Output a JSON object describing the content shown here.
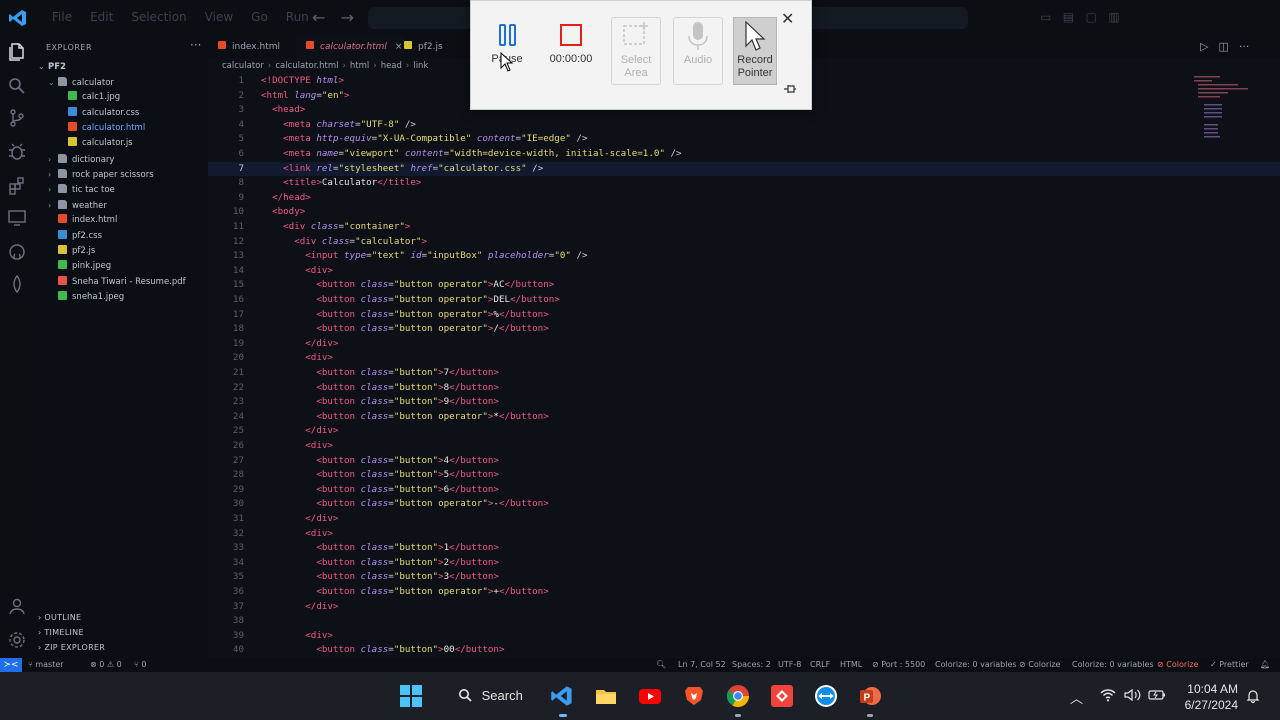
{
  "window": {
    "menu": [
      "File",
      "Edit",
      "Selection",
      "View",
      "Go",
      "Run"
    ]
  },
  "sidebar": {
    "header": "EXPLORER",
    "more": "···",
    "root": "PF2",
    "items": [
      {
        "label": "calculator",
        "type": "folder",
        "open": true,
        "indent": 1
      },
      {
        "label": "calc1.jpg",
        "type": "img",
        "indent": 2
      },
      {
        "label": "calculator.css",
        "type": "css",
        "indent": 2
      },
      {
        "label": "calculator.html",
        "type": "html",
        "indent": 2,
        "active": true
      },
      {
        "label": "calculator.js",
        "type": "js",
        "indent": 2
      },
      {
        "label": "dictionary",
        "type": "folder",
        "indent": 1
      },
      {
        "label": "rock paper scissors",
        "type": "folder",
        "indent": 1
      },
      {
        "label": "tic tac toe",
        "type": "folder",
        "indent": 1
      },
      {
        "label": "weather",
        "type": "folder",
        "indent": 1
      },
      {
        "label": "index.html",
        "type": "html",
        "indent": 1
      },
      {
        "label": "pf2.css",
        "type": "css",
        "indent": 1
      },
      {
        "label": "pf2.js",
        "type": "js",
        "indent": 1
      },
      {
        "label": "pink.jpeg",
        "type": "img",
        "indent": 1
      },
      {
        "label": "Sneha Tiwari - Resume.pdf",
        "type": "pdf",
        "indent": 1
      },
      {
        "label": "sneha1.jpeg",
        "type": "img",
        "indent": 1
      }
    ],
    "sections": [
      "OUTLINE",
      "TIMELINE",
      "ZIP EXPLORER"
    ]
  },
  "tabs": [
    {
      "label": "index.html",
      "type": "html"
    },
    {
      "label": "calculator.html",
      "type": "html",
      "active": true,
      "close": "×"
    },
    {
      "label": "pf2.js",
      "type": "js"
    }
  ],
  "breadcrumb": [
    "calculator",
    "calculator.html",
    "html",
    "head",
    "link"
  ],
  "editor": {
    "current_line": 7,
    "lines": [
      [
        [
          "doc",
          "<!DOCTYPE "
        ],
        [
          "attr",
          "html"
        ],
        [
          "doc",
          ">"
        ]
      ],
      [
        [
          "tag",
          "<html "
        ],
        [
          "attr",
          "lang"
        ],
        [
          "punc",
          "="
        ],
        [
          "str",
          "\"en\""
        ],
        [
          "tag",
          ">"
        ]
      ],
      [
        [
          "txt",
          "  "
        ],
        [
          "tag",
          "<head>"
        ]
      ],
      [
        [
          "txt",
          "    "
        ],
        [
          "tag",
          "<meta "
        ],
        [
          "attr",
          "charset"
        ],
        [
          "punc",
          "="
        ],
        [
          "str",
          "\"UTF-8\""
        ],
        [
          "punc",
          " />"
        ]
      ],
      [
        [
          "txt",
          "    "
        ],
        [
          "tag",
          "<meta "
        ],
        [
          "attr",
          "http-equiv"
        ],
        [
          "punc",
          "="
        ],
        [
          "str",
          "\"X-UA-Compatible\""
        ],
        [
          "punc",
          " "
        ],
        [
          "attr",
          "content"
        ],
        [
          "punc",
          "="
        ],
        [
          "str",
          "\"IE=edge\""
        ],
        [
          "punc",
          " />"
        ]
      ],
      [
        [
          "txt",
          "    "
        ],
        [
          "tag",
          "<meta "
        ],
        [
          "attr",
          "name"
        ],
        [
          "punc",
          "="
        ],
        [
          "str",
          "\"viewport\""
        ],
        [
          "punc",
          " "
        ],
        [
          "attr",
          "content"
        ],
        [
          "punc",
          "="
        ],
        [
          "str",
          "\"width=device-width, initial-scale=1.0\""
        ],
        [
          "punc",
          " />"
        ]
      ],
      [
        [
          "txt",
          "    "
        ],
        [
          "tag",
          "<link "
        ],
        [
          "attr",
          "rel"
        ],
        [
          "punc",
          "="
        ],
        [
          "str",
          "\"stylesheet\""
        ],
        [
          "punc",
          " "
        ],
        [
          "attr",
          "href"
        ],
        [
          "punc",
          "="
        ],
        [
          "str",
          "\"calculator.css\""
        ],
        [
          "punc",
          " />"
        ]
      ],
      [
        [
          "txt",
          "    "
        ],
        [
          "tag",
          "<title>"
        ],
        [
          "txt",
          "Calculator"
        ],
        [
          "tag",
          "</title>"
        ]
      ],
      [
        [
          "txt",
          "  "
        ],
        [
          "tag",
          "</head>"
        ]
      ],
      [
        [
          "txt",
          "  "
        ],
        [
          "tag",
          "<body>"
        ]
      ],
      [
        [
          "txt",
          "    "
        ],
        [
          "tag",
          "<div "
        ],
        [
          "attr",
          "class"
        ],
        [
          "punc",
          "="
        ],
        [
          "str",
          "\"container\""
        ],
        [
          "tag",
          ">"
        ]
      ],
      [
        [
          "txt",
          "      "
        ],
        [
          "tag",
          "<div "
        ],
        [
          "attr",
          "class"
        ],
        [
          "punc",
          "="
        ],
        [
          "str",
          "\"calculator\""
        ],
        [
          "tag",
          ">"
        ]
      ],
      [
        [
          "txt",
          "        "
        ],
        [
          "tag",
          "<input "
        ],
        [
          "attr",
          "type"
        ],
        [
          "punc",
          "="
        ],
        [
          "str",
          "\"text\""
        ],
        [
          "punc",
          " "
        ],
        [
          "attr",
          "id"
        ],
        [
          "punc",
          "="
        ],
        [
          "str",
          "\"inputBox\""
        ],
        [
          "punc",
          " "
        ],
        [
          "attr",
          "placeholder"
        ],
        [
          "punc",
          "="
        ],
        [
          "str",
          "\"0\""
        ],
        [
          "punc",
          " />"
        ]
      ],
      [
        [
          "txt",
          "        "
        ],
        [
          "tag",
          "<div>"
        ]
      ],
      [
        [
          "txt",
          "          "
        ],
        [
          "tag",
          "<button "
        ],
        [
          "attr",
          "class"
        ],
        [
          "punc",
          "="
        ],
        [
          "str",
          "\"button operator\""
        ],
        [
          "tag",
          ">"
        ],
        [
          "txt",
          "AC"
        ],
        [
          "tag",
          "</button>"
        ]
      ],
      [
        [
          "txt",
          "          "
        ],
        [
          "tag",
          "<button "
        ],
        [
          "attr",
          "class"
        ],
        [
          "punc",
          "="
        ],
        [
          "str",
          "\"button operator\""
        ],
        [
          "tag",
          ">"
        ],
        [
          "txt",
          "DEL"
        ],
        [
          "tag",
          "</button>"
        ]
      ],
      [
        [
          "txt",
          "          "
        ],
        [
          "tag",
          "<button "
        ],
        [
          "attr",
          "class"
        ],
        [
          "punc",
          "="
        ],
        [
          "str",
          "\"button operator\""
        ],
        [
          "tag",
          ">"
        ],
        [
          "txt",
          "%"
        ],
        [
          "tag",
          "</button>"
        ]
      ],
      [
        [
          "txt",
          "          "
        ],
        [
          "tag",
          "<button "
        ],
        [
          "attr",
          "class"
        ],
        [
          "punc",
          "="
        ],
        [
          "str",
          "\"button operator\""
        ],
        [
          "tag",
          ">"
        ],
        [
          "txt",
          "/"
        ],
        [
          "tag",
          "</button>"
        ]
      ],
      [
        [
          "txt",
          "        "
        ],
        [
          "tag",
          "</div>"
        ]
      ],
      [
        [
          "txt",
          "        "
        ],
        [
          "tag",
          "<div>"
        ]
      ],
      [
        [
          "txt",
          "          "
        ],
        [
          "tag",
          "<button "
        ],
        [
          "attr",
          "class"
        ],
        [
          "punc",
          "="
        ],
        [
          "str",
          "\"button\""
        ],
        [
          "tag",
          ">"
        ],
        [
          "txt",
          "7"
        ],
        [
          "tag",
          "</button>"
        ]
      ],
      [
        [
          "txt",
          "          "
        ],
        [
          "tag",
          "<button "
        ],
        [
          "attr",
          "class"
        ],
        [
          "punc",
          "="
        ],
        [
          "str",
          "\"button\""
        ],
        [
          "tag",
          ">"
        ],
        [
          "txt",
          "8"
        ],
        [
          "tag",
          "</button>"
        ]
      ],
      [
        [
          "txt",
          "          "
        ],
        [
          "tag",
          "<button "
        ],
        [
          "attr",
          "class"
        ],
        [
          "punc",
          "="
        ],
        [
          "str",
          "\"button\""
        ],
        [
          "tag",
          ">"
        ],
        [
          "txt",
          "9"
        ],
        [
          "tag",
          "</button>"
        ]
      ],
      [
        [
          "txt",
          "          "
        ],
        [
          "tag",
          "<button "
        ],
        [
          "attr",
          "class"
        ],
        [
          "punc",
          "="
        ],
        [
          "str",
          "\"button operator\""
        ],
        [
          "tag",
          ">"
        ],
        [
          "txt",
          "*"
        ],
        [
          "tag",
          "</button>"
        ]
      ],
      [
        [
          "txt",
          "        "
        ],
        [
          "tag",
          "</div>"
        ]
      ],
      [
        [
          "txt",
          "        "
        ],
        [
          "tag",
          "<div>"
        ]
      ],
      [
        [
          "txt",
          "          "
        ],
        [
          "tag",
          "<button "
        ],
        [
          "attr",
          "class"
        ],
        [
          "punc",
          "="
        ],
        [
          "str",
          "\"button\""
        ],
        [
          "tag",
          ">"
        ],
        [
          "txt",
          "4"
        ],
        [
          "tag",
          "</button>"
        ]
      ],
      [
        [
          "txt",
          "          "
        ],
        [
          "tag",
          "<button "
        ],
        [
          "attr",
          "class"
        ],
        [
          "punc",
          "="
        ],
        [
          "str",
          "\"button\""
        ],
        [
          "tag",
          ">"
        ],
        [
          "txt",
          "5"
        ],
        [
          "tag",
          "</button>"
        ]
      ],
      [
        [
          "txt",
          "          "
        ],
        [
          "tag",
          "<button "
        ],
        [
          "attr",
          "class"
        ],
        [
          "punc",
          "="
        ],
        [
          "str",
          "\"button\""
        ],
        [
          "tag",
          ">"
        ],
        [
          "txt",
          "6"
        ],
        [
          "tag",
          "</button>"
        ]
      ],
      [
        [
          "txt",
          "          "
        ],
        [
          "tag",
          "<button "
        ],
        [
          "attr",
          "class"
        ],
        [
          "punc",
          "="
        ],
        [
          "str",
          "\"button operator\""
        ],
        [
          "tag",
          ">"
        ],
        [
          "txt",
          "-"
        ],
        [
          "tag",
          "</button>"
        ]
      ],
      [
        [
          "txt",
          "        "
        ],
        [
          "tag",
          "</div>"
        ]
      ],
      [
        [
          "txt",
          "        "
        ],
        [
          "tag",
          "<div>"
        ]
      ],
      [
        [
          "txt",
          "          "
        ],
        [
          "tag",
          "<button "
        ],
        [
          "attr",
          "class"
        ],
        [
          "punc",
          "="
        ],
        [
          "str",
          "\"button\""
        ],
        [
          "tag",
          ">"
        ],
        [
          "txt",
          "1"
        ],
        [
          "tag",
          "</button>"
        ]
      ],
      [
        [
          "txt",
          "          "
        ],
        [
          "tag",
          "<button "
        ],
        [
          "attr",
          "class"
        ],
        [
          "punc",
          "="
        ],
        [
          "str",
          "\"button\""
        ],
        [
          "tag",
          ">"
        ],
        [
          "txt",
          "2"
        ],
        [
          "tag",
          "</button>"
        ]
      ],
      [
        [
          "txt",
          "          "
        ],
        [
          "tag",
          "<button "
        ],
        [
          "attr",
          "class"
        ],
        [
          "punc",
          "="
        ],
        [
          "str",
          "\"button\""
        ],
        [
          "tag",
          ">"
        ],
        [
          "txt",
          "3"
        ],
        [
          "tag",
          "</button>"
        ]
      ],
      [
        [
          "txt",
          "          "
        ],
        [
          "tag",
          "<button "
        ],
        [
          "attr",
          "class"
        ],
        [
          "punc",
          "="
        ],
        [
          "str",
          "\"button operator\""
        ],
        [
          "tag",
          ">"
        ],
        [
          "txt",
          "+"
        ],
        [
          "tag",
          "</button>"
        ]
      ],
      [
        [
          "txt",
          "        "
        ],
        [
          "tag",
          "</div>"
        ]
      ],
      [],
      [
        [
          "txt",
          "        "
        ],
        [
          "tag",
          "<div>"
        ]
      ],
      [
        [
          "txt",
          "          "
        ],
        [
          "tag",
          "<button "
        ],
        [
          "attr",
          "class"
        ],
        [
          "punc",
          "="
        ],
        [
          "str",
          "\"button\""
        ],
        [
          "tag",
          ">"
        ],
        [
          "txt",
          "00"
        ],
        [
          "tag",
          "</button>"
        ]
      ]
    ]
  },
  "recorder": {
    "pause_label": "Pause",
    "timer": "00:00:00",
    "select_area_label": "Select Area",
    "audio_label": "Audio",
    "record_pointer_label": "Record Pointer",
    "close": "✕"
  },
  "statusbar": {
    "branch": "master",
    "problems": "⊗ 0 ⚠ 0",
    "ports": "⑂ 0",
    "cursor": "Ln 7, Col 52",
    "spaces": "Spaces: 2",
    "encoding": "UTF-8",
    "eol": "CRLF",
    "language": "HTML",
    "port": "Port : 5500",
    "colorize1": "Colorize: 0 variables",
    "colorize2": "Colorize",
    "colorize3": "Colorize: 0 variables",
    "colorize4": "Colorize",
    "prettier": "Prettier"
  },
  "taskbar": {
    "search_label": "Search",
    "time": "10:04 AM",
    "date": "6/27/2024",
    "accent": "#1f6feb"
  }
}
